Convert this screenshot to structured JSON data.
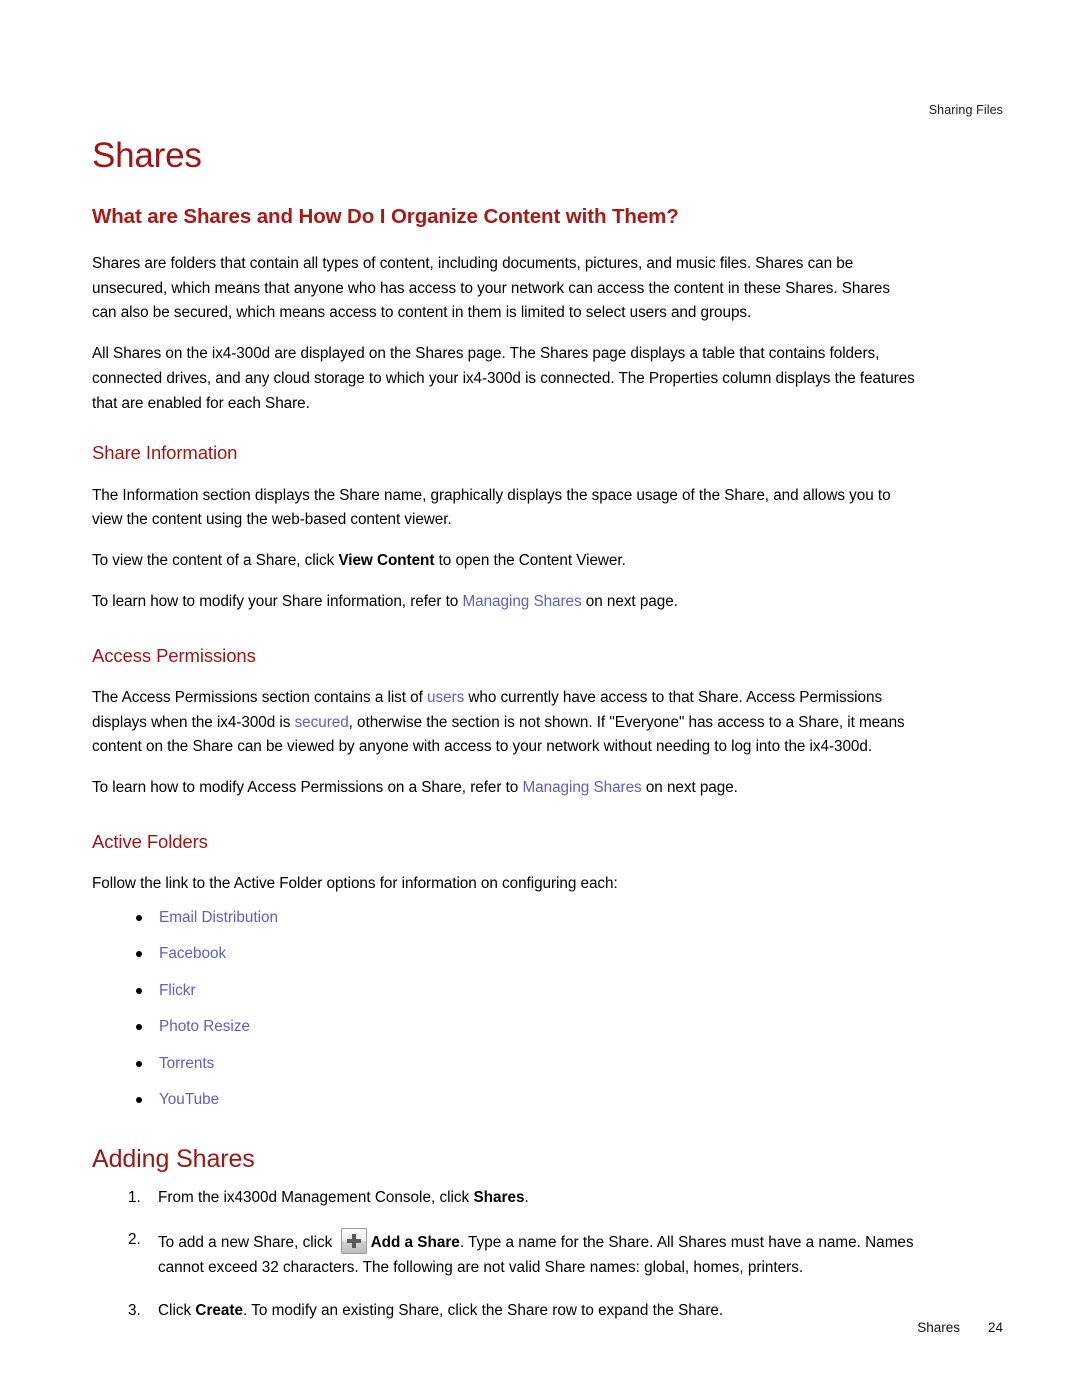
{
  "header": {
    "running_head": "Sharing Files"
  },
  "doc": {
    "title": "Shares"
  },
  "sections": {
    "overview": {
      "heading": "What are Shares and How Do I Organize Content with Them?",
      "paragraph_1": "Shares are folders that contain all types of content, including documents, pictures, and music files. Shares can be unsecured, which means that anyone who has access to your network can access the content in these Shares. Shares can also be secured, which means access to content in them is limited to select users and groups.",
      "paragraph_2": "All Shares on the ix4-300d are displayed on the Shares page. The Shares page displays a table that contains folders, connected drives, and any cloud storage to which your ix4-300d is connected. The Properties column displays the features that are enabled for each Share."
    },
    "share_information": {
      "heading": "Share Information",
      "paragraph_1": "The Information section displays the Share name, graphically displays the space usage of the Share, and allows you to view the content using the web-based content viewer.",
      "view_content_pre": "To view the content of a Share, click ",
      "view_content_bold": "View Content",
      "view_content_post": " to open the Content Viewer.",
      "refer_pre": "To learn how to modify your Share information, refer to ",
      "refer_link": "Managing Shares",
      "refer_post": " on next page."
    },
    "access_permissions": {
      "heading": "Access Permissions",
      "paragraph_part_1": "The Access Permissions section contains a list of ",
      "link_users": "users",
      "paragraph_part_2": " who currently have access to that Share. Access Permissions displays when the ix4-300d is ",
      "link_secured": "secured",
      "paragraph_part_3": ", otherwise the section is not shown. If \"Everyone\" has access to a Share, it means content on the Share can be viewed by anyone with access to your network without needing to log into the ix4-300d.",
      "refer_pre": "To learn how to modify Access Permissions on a Share, refer to ",
      "refer_link": "Managing Shares",
      "refer_post": " on next page."
    },
    "active_folders": {
      "heading": "Active Folders",
      "intro": "Follow the link to the Active Folder options for information on configuring each:",
      "items": [
        "Email Distribution",
        "Facebook",
        "Flickr",
        "Photo Resize",
        "Torrents",
        "YouTube"
      ]
    },
    "adding_shares": {
      "heading": "Adding Shares",
      "steps": [
        {
          "number": "1.",
          "pre": "From the ix4300d Management Console, click ",
          "bold": "Shares",
          "post": "."
        },
        {
          "number": "2.",
          "pre": "To add a new Share, click ",
          "icon": "plus-icon",
          "bold": "Add a Share",
          "post": ". Type a name for the Share. All Shares must have a name. Names cannot exceed 32 characters. The following are not valid Share names: global, homes, printers."
        },
        {
          "number": "3.",
          "pre": "Click ",
          "bold": "Create",
          "post": ". To modify an existing Share, click the Share row to expand the Share."
        }
      ]
    }
  },
  "footer": {
    "label": "Shares",
    "page_number": "24"
  },
  "colors": {
    "heading_red": "#9E1515",
    "heading_red_bold": "#A71A17",
    "link_purple": "#5E5EBE",
    "body_black": "#000000"
  }
}
